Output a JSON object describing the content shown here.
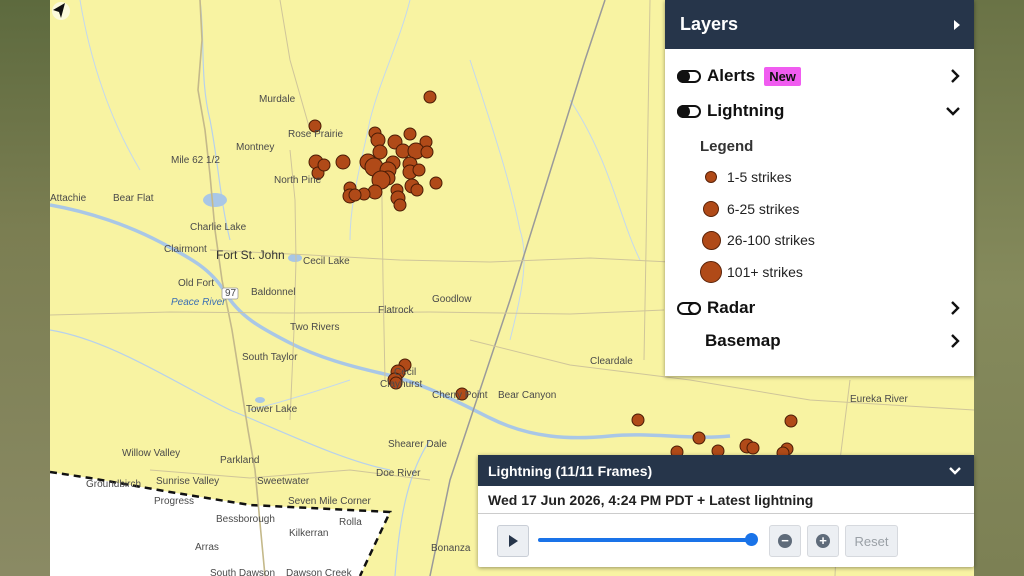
{
  "map": {
    "places": [
      {
        "name": "Murdale",
        "cls": ""
      },
      {
        "name": "Rose Prairie",
        "cls": ""
      },
      {
        "name": "Montney",
        "cls": ""
      },
      {
        "name": "Mile 62 1/2",
        "cls": ""
      },
      {
        "name": "North Pine",
        "cls": ""
      },
      {
        "name": "Attachie",
        "cls": ""
      },
      {
        "name": "Bear Flat",
        "cls": ""
      },
      {
        "name": "Charlie Lake",
        "cls": ""
      },
      {
        "name": "Clairmont",
        "cls": ""
      },
      {
        "name": "Fort St. John",
        "cls": "big"
      },
      {
        "name": "Old Fort",
        "cls": ""
      },
      {
        "name": "Cecil Lake",
        "cls": ""
      },
      {
        "name": "Baldonnel",
        "cls": ""
      },
      {
        "name": "Peace River",
        "cls": "water"
      },
      {
        "name": "97",
        "cls": ""
      },
      {
        "name": "Goodlow",
        "cls": ""
      },
      {
        "name": "Flatrock",
        "cls": ""
      },
      {
        "name": "Two Rivers",
        "cls": ""
      },
      {
        "name": "South Taylor",
        "cls": ""
      },
      {
        "name": "Cleardale",
        "cls": ""
      },
      {
        "name": "Cherry Point",
        "cls": ""
      },
      {
        "name": "Bear Canyon",
        "cls": ""
      },
      {
        "name": "Cecil",
        "cls": ""
      },
      {
        "name": "Clayhurst",
        "cls": ""
      },
      {
        "name": "Tower Lake",
        "cls": ""
      },
      {
        "name": "Eureka River",
        "cls": ""
      },
      {
        "name": "Shearer Dale",
        "cls": ""
      },
      {
        "name": "Willow Valley",
        "cls": ""
      },
      {
        "name": "Parkland",
        "cls": ""
      },
      {
        "name": "Doe River",
        "cls": ""
      },
      {
        "name": "Sunrise Valley",
        "cls": ""
      },
      {
        "name": "Sweetwater",
        "cls": ""
      },
      {
        "name": "Groundbirch",
        "cls": ""
      },
      {
        "name": "Seven Mile Corner",
        "cls": ""
      },
      {
        "name": "Progress",
        "cls": ""
      },
      {
        "name": "Bessborough",
        "cls": ""
      },
      {
        "name": "Rolla",
        "cls": ""
      },
      {
        "name": "Kilkerran",
        "cls": ""
      },
      {
        "name": "Arras",
        "cls": ""
      },
      {
        "name": "Bonanza",
        "cls": ""
      },
      {
        "name": "South Dawson",
        "cls": ""
      },
      {
        "name": "Dawson Creek",
        "cls": ""
      }
    ]
  },
  "layers": {
    "title": "Layers",
    "items": {
      "alerts": {
        "label": "Alerts",
        "badge": "New",
        "toggle": "on"
      },
      "lightning": {
        "label": "Lightning",
        "toggle": "on"
      },
      "radar": {
        "label": "Radar",
        "toggle": "off"
      },
      "basemap": {
        "label": "Basemap"
      }
    },
    "legend": {
      "title": "Legend",
      "entries": [
        "1-5 strikes",
        "6-25 strikes",
        "26-100 strikes",
        "101+ strikes"
      ]
    }
  },
  "animation": {
    "title": "Lightning (11/11 Frames)",
    "timestamp": "Wed 17 Jun 2026, 4:24 PM PDT + Latest lightning",
    "progress": 1.0,
    "reset_label": "Reset"
  },
  "colors": {
    "map_land": "#f8f3a2",
    "panel_header": "#26354a",
    "strike_fill": "#b04a18",
    "new_badge": "#f05cf0",
    "slider": "#1a73e8"
  }
}
